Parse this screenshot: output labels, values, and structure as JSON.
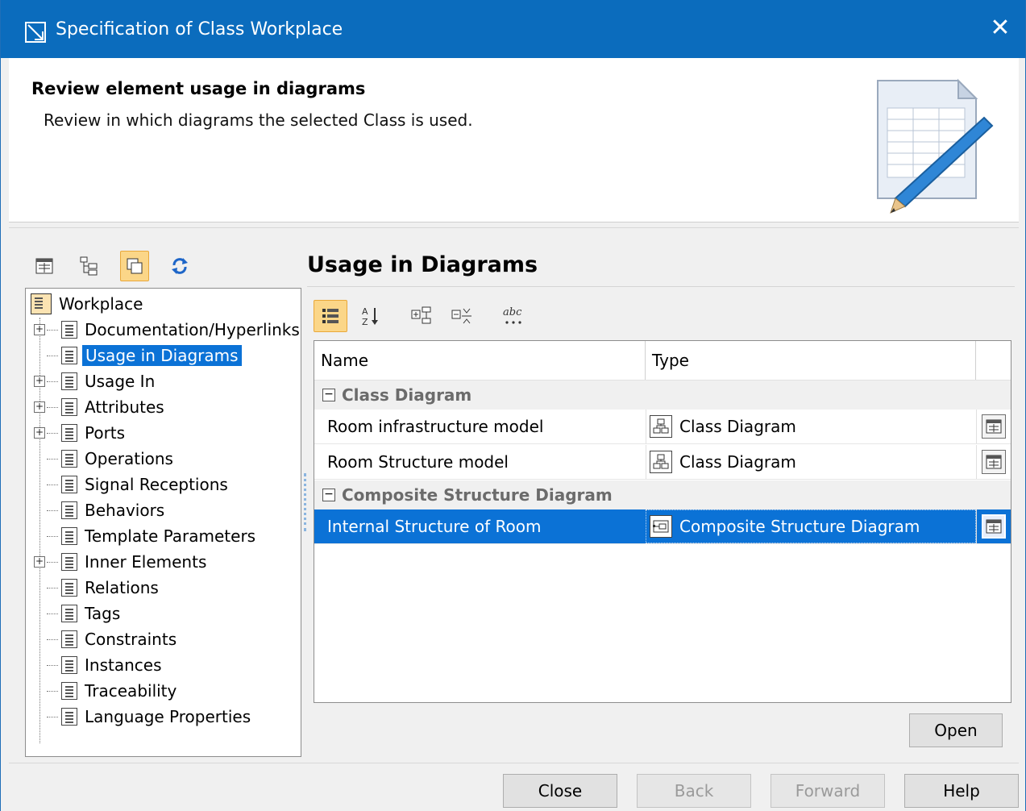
{
  "window": {
    "title": "Specification of Class Workplace",
    "close_symbol": "✕"
  },
  "header": {
    "title": "Review element usage in diagrams",
    "description": "Review in which diagrams the selected Class is used."
  },
  "tree": {
    "root": "Workplace",
    "items": [
      {
        "label": "Documentation/Hyperlinks",
        "expandable": true
      },
      {
        "label": "Usage in Diagrams",
        "expandable": false,
        "selected": true
      },
      {
        "label": "Usage In",
        "expandable": true
      },
      {
        "label": "Attributes",
        "expandable": true
      },
      {
        "label": "Ports",
        "expandable": true
      },
      {
        "label": "Operations",
        "expandable": false
      },
      {
        "label": "Signal Receptions",
        "expandable": false
      },
      {
        "label": "Behaviors",
        "expandable": false
      },
      {
        "label": "Template Parameters",
        "expandable": false
      },
      {
        "label": "Inner Elements",
        "expandable": true
      },
      {
        "label": "Relations",
        "expandable": false
      },
      {
        "label": "Tags",
        "expandable": false
      },
      {
        "label": "Constraints",
        "expandable": false
      },
      {
        "label": "Instances",
        "expandable": false
      },
      {
        "label": "Traceability",
        "expandable": false
      },
      {
        "label": "Language Properties",
        "expandable": false
      }
    ]
  },
  "panel": {
    "title": "Usage in Diagrams"
  },
  "table": {
    "columns": {
      "name": "Name",
      "type": "Type"
    },
    "groups": [
      {
        "label": "Class Diagram",
        "rows": [
          {
            "name": "Room infrastructure model",
            "type": "Class Diagram"
          },
          {
            "name": "Room Structure model",
            "type": "Class Diagram"
          }
        ]
      },
      {
        "label": "Composite Structure Diagram",
        "rows": [
          {
            "name": "Internal Structure of Room",
            "type": "Composite Structure Diagram",
            "selected": true
          }
        ]
      }
    ]
  },
  "buttons": {
    "open": "Open",
    "close": "Close",
    "back": "Back",
    "forward": "Forward",
    "help": "Help"
  },
  "colors": {
    "titlebar": "#0b6cbd",
    "selection": "#0b72d6",
    "toolbar_active": "#fbd688"
  },
  "icons": {
    "window": "diagram-window-icon",
    "toolbar_left": [
      "table-view-icon",
      "tree-view-icon",
      "window-overlap-icon",
      "refresh-icon"
    ],
    "toolbar_right": [
      "group-by-icon",
      "sort-az-icon",
      "expand-all-icon",
      "collapse-all-icon",
      "text-options-icon"
    ]
  }
}
